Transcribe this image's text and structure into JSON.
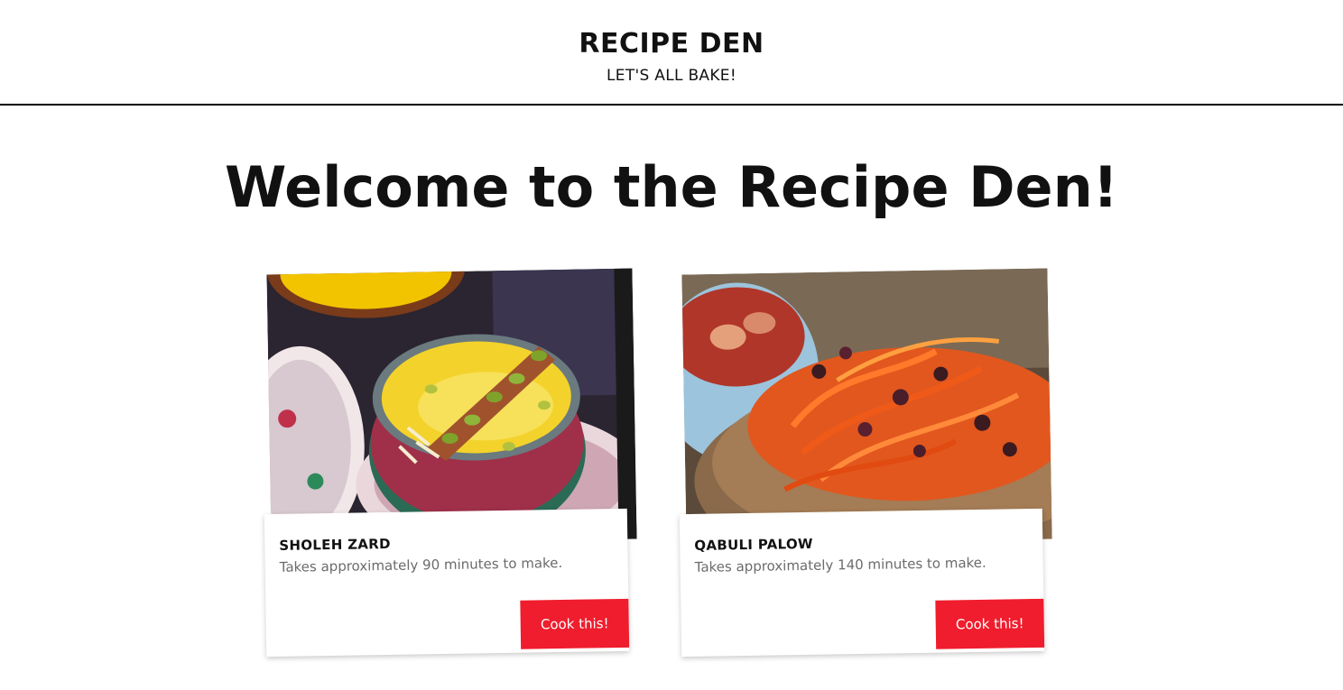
{
  "header": {
    "title": "RECIPE DEN",
    "tagline": "LET'S ALL BAKE!"
  },
  "main": {
    "heading": "Welcome to the Recipe Den!",
    "cards": [
      {
        "title": "SHOLEH ZARD",
        "description": "Takes approximately 90 minutes to make.",
        "button_label": "Cook this!",
        "image_name": "sholeh-zard-photo"
      },
      {
        "title": "QABULI PALOW",
        "description": "Takes approximately 140 minutes to make.",
        "button_label": "Cook this!",
        "image_name": "qabuli-palow-photo"
      }
    ]
  },
  "colors": {
    "button_bg": "#ef1d2d",
    "button_text": "#ffffff",
    "header_rule": "#000000",
    "description_text": "#6b6b6b"
  }
}
